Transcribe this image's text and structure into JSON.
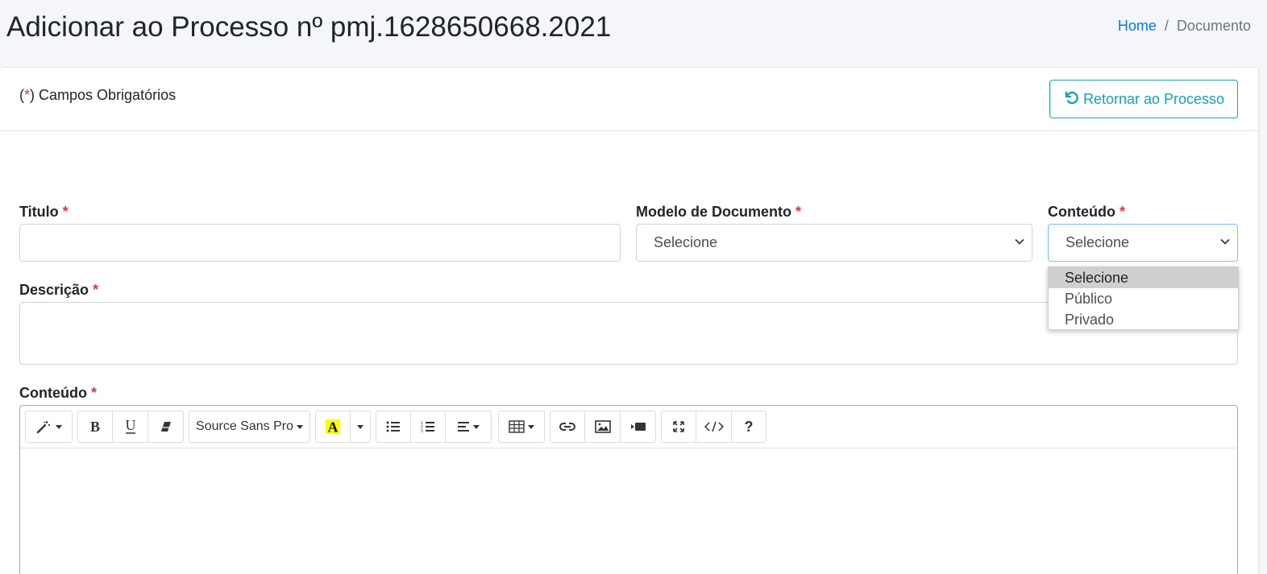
{
  "header": {
    "title": "Adicionar ao Processo nº pmj.1628650668.2021",
    "breadcrumb": {
      "home": "Home",
      "separator": "/",
      "current": "Documento"
    }
  },
  "toolbar": {
    "return_label": "Retornar ao Processo"
  },
  "form": {
    "required_note_open": "(",
    "required_star": "*",
    "required_note_close": ") Campos Obrigatórios",
    "titulo_label": "Titulo",
    "titulo_value": "",
    "modelo_label": "Modelo de Documento",
    "modelo_value": "Selecione",
    "conteudo_select_label": "Conteúdo",
    "conteudo_select_value": "Selecione",
    "conteudo_options": [
      "Selecione",
      "Público",
      "Privado"
    ],
    "descricao_label": "Descrição",
    "descricao_value": "",
    "conteudo_editor_label": "Conteúdo"
  },
  "editor": {
    "font_name": "Source Sans Pro",
    "highlight_color": "#ffff00"
  },
  "colors": {
    "accent": "#17a2b8",
    "link": "#007bff",
    "required": "#dc3545"
  }
}
